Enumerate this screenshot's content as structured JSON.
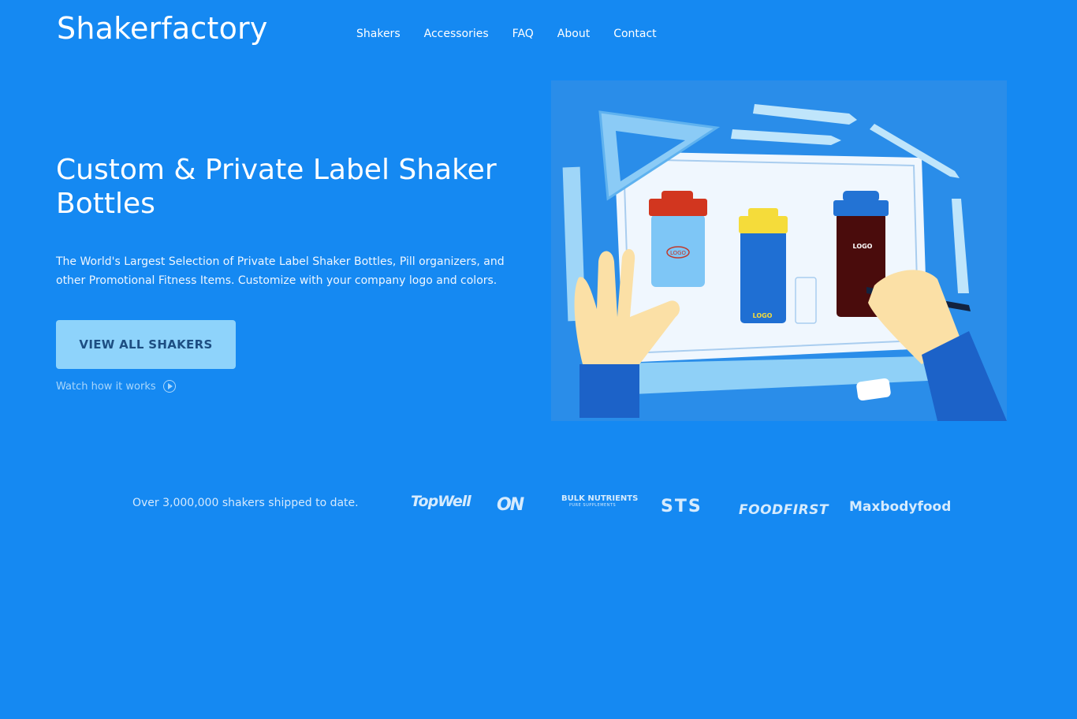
{
  "header": {
    "logo_text": "Shakerfactory",
    "nav": [
      "Shakers",
      "Accessories",
      "FAQ",
      "About",
      "Contact"
    ]
  },
  "hero": {
    "title": "Custom & Private Label Shaker Bottles",
    "subtitle": "The World's Largest Selection of Private Label Shaker Bottles, Pill organizers, and other Promotional Fitness Items. Customize with your company logo and colors.",
    "cta_label": "VIEW ALL SHAKERS",
    "watch_label": "Watch how it works",
    "illustration": {
      "bottle_logo_labels": [
        "LOGO",
        "LOGO",
        "LOGO"
      ]
    }
  },
  "clients": {
    "shipped_text": "Over 3,000,000 shakers shipped to date.",
    "brands": {
      "topwell": "TopWell",
      "on": "ON",
      "bulk": "BULK NUTRIENTS",
      "bulk_sub": "PURE SUPPLEMENTS",
      "sts": "STS",
      "foodfirst": "FOODFIRST",
      "maxbody": "Maxbodyfood"
    }
  },
  "colors": {
    "background": "#1589f2",
    "cta_background": "#8ed3fb",
    "cta_text": "#1d4e82"
  },
  "icons": {
    "watch_icon": "play-circle-icon"
  }
}
